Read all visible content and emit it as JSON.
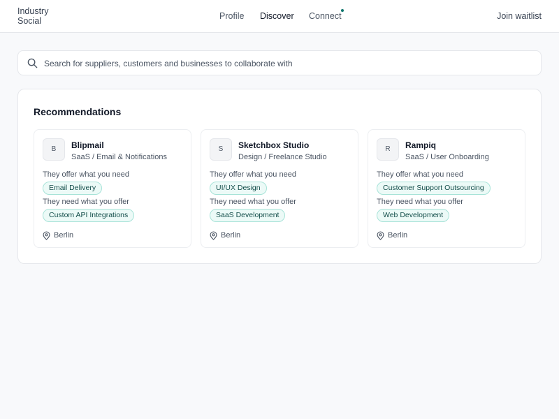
{
  "header": {
    "brand": "Industry Social",
    "nav": [
      {
        "label": "Profile"
      },
      {
        "label": "Discover"
      },
      {
        "label": "Connect"
      }
    ],
    "join_label": "Join waitlist"
  },
  "search": {
    "placeholder": "Search for suppliers, customers and businesses to collaborate with"
  },
  "recommendations": {
    "title": "Recommendations",
    "offer_label": "They offer what you need",
    "need_label": "They need what you offer",
    "cards": [
      {
        "initial": "B",
        "name": "Blipmail",
        "category": "SaaS / Email & Notifications",
        "offers": "Email Delivery",
        "needs": "Custom API Integrations",
        "location": "Berlin"
      },
      {
        "initial": "S",
        "name": "Sketchbox Studio",
        "category": "Design / Freelance Studio",
        "offers": "UI/UX Design",
        "needs": "SaaS Development",
        "location": "Berlin"
      },
      {
        "initial": "R",
        "name": "Rampiq",
        "category": "SaaS / User Onboarding",
        "offers": "Customer Support Outsourcing",
        "needs": "Web Development",
        "location": "Berlin"
      }
    ]
  },
  "colors": {
    "accent": "#0f766e",
    "tag_bg": "#ecfaf7",
    "tag_border": "#a7e3d8",
    "page_bg": "#f8f9fb"
  },
  "icons": {
    "search": "search-icon",
    "location": "map-pin-icon",
    "notification": "notification-dot"
  }
}
